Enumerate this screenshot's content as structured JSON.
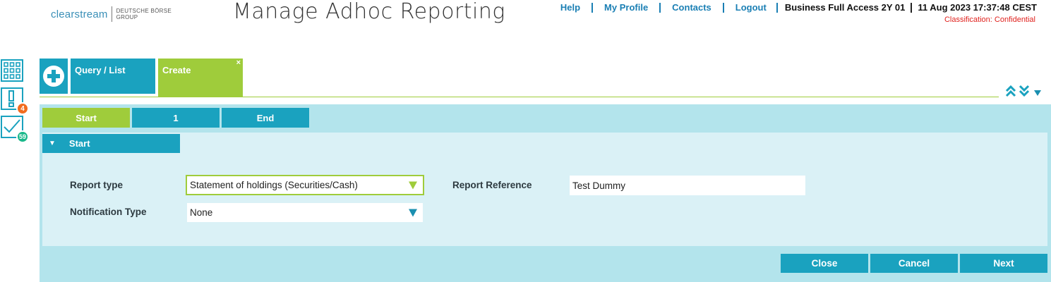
{
  "header": {
    "brand": "clearstream",
    "brand_group_line1": "DEUTSCHE BÖRSE",
    "brand_group_line2": "GROUP",
    "title": "Manage Adhoc Reporting",
    "nav": {
      "help": "Help",
      "profile": "My Profile",
      "contacts": "Contacts",
      "logout": "Logout"
    },
    "user_access": "Business Full Access 2Y 01",
    "datetime": "11 Aug 2023 17:37:48 CEST",
    "classification": "Classification: Confidential"
  },
  "sidebar": {
    "alerts_count": "4",
    "tasks_count": "59",
    "icons": [
      "grid-icon",
      "alert-icon",
      "checkmark-icon"
    ]
  },
  "tabs": {
    "query_list": "Query / List",
    "create": "Create",
    "close_glyph": "×"
  },
  "steps": {
    "start": "Start",
    "one": "1",
    "end": "End"
  },
  "section": {
    "title": "Start"
  },
  "form": {
    "report_type_label": "Report type",
    "report_type_value": "Statement of holdings (Securities/Cash)",
    "notification_type_label": "Notification Type",
    "notification_type_value": "None",
    "report_reference_label": "Report Reference",
    "report_reference_value": "Test Dummy"
  },
  "buttons": {
    "close": "Close",
    "cancel": "Cancel",
    "next": "Next"
  },
  "colors": {
    "teal": "#1aa2bf",
    "green": "#9fcc3b",
    "panel": "#b3e4ec",
    "section": "#daf1f6",
    "alert_badge": "#f26c1f",
    "task_badge": "#1ab88a",
    "classification": "#e0221e"
  }
}
